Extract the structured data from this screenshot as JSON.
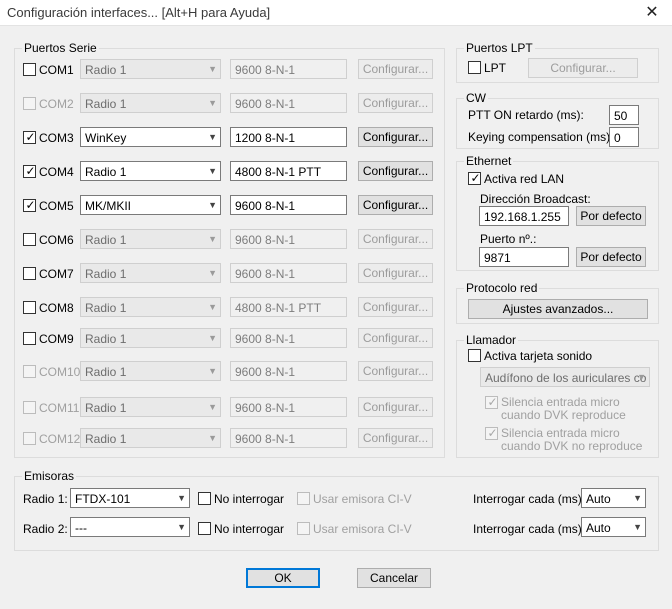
{
  "window": {
    "title": "Configuración interfaces... [Alt+H para Ayuda]",
    "close_glyph": "✕"
  },
  "puertos_serie": {
    "legend": "Puertos Serie",
    "ports": [
      {
        "name": "COM1",
        "checked": false,
        "enabled": true,
        "radio": "Radio 1",
        "radio_enabled": false,
        "speed": "9600 8-N-1",
        "speed_enabled": false,
        "configure": "Configurar...",
        "configure_enabled": false
      },
      {
        "name": "COM2",
        "checked": false,
        "enabled": false,
        "radio": "Radio 1",
        "radio_enabled": false,
        "speed": "9600 8-N-1",
        "speed_enabled": false,
        "configure": "Configurar...",
        "configure_enabled": false
      },
      {
        "name": "COM3",
        "checked": true,
        "enabled": true,
        "radio": "WinKey",
        "radio_enabled": true,
        "speed": "1200 8-N-1",
        "speed_enabled": true,
        "configure": "Configurar...",
        "configure_enabled": true
      },
      {
        "name": "COM4",
        "checked": true,
        "enabled": true,
        "radio": "Radio 1",
        "radio_enabled": true,
        "speed": "4800 8-N-1 PTT",
        "speed_enabled": true,
        "configure": "Configurar...",
        "configure_enabled": true
      },
      {
        "name": "COM5",
        "checked": true,
        "enabled": true,
        "radio": "MK/MKII",
        "radio_enabled": true,
        "speed": "9600 8-N-1",
        "speed_enabled": true,
        "configure": "Configurar...",
        "configure_enabled": true
      },
      {
        "name": "COM6",
        "checked": false,
        "enabled": true,
        "radio": "Radio 1",
        "radio_enabled": false,
        "speed": "9600 8-N-1",
        "speed_enabled": false,
        "configure": "Configurar...",
        "configure_enabled": false
      },
      {
        "name": "COM7",
        "checked": false,
        "enabled": true,
        "radio": "Radio 1",
        "radio_enabled": false,
        "speed": "9600 8-N-1",
        "speed_enabled": false,
        "configure": "Configurar...",
        "configure_enabled": false
      },
      {
        "name": "COM8",
        "checked": false,
        "enabled": true,
        "radio": "Radio 1",
        "radio_enabled": false,
        "speed": "4800 8-N-1 PTT",
        "speed_enabled": false,
        "configure": "Configurar...",
        "configure_enabled": false
      },
      {
        "name": "COM9",
        "checked": false,
        "enabled": true,
        "radio": "Radio 1",
        "radio_enabled": false,
        "speed": "9600 8-N-1",
        "speed_enabled": false,
        "configure": "Configurar...",
        "configure_enabled": false
      },
      {
        "name": "COM10",
        "checked": false,
        "enabled": false,
        "radio": "Radio 1",
        "radio_enabled": false,
        "speed": "9600 8-N-1",
        "speed_enabled": false,
        "configure": "Configurar...",
        "configure_enabled": false
      },
      {
        "name": "COM11",
        "checked": false,
        "enabled": false,
        "radio": "Radio 1",
        "radio_enabled": false,
        "speed": "9600 8-N-1",
        "speed_enabled": false,
        "configure": "Configurar...",
        "configure_enabled": false
      },
      {
        "name": "COM12",
        "checked": false,
        "enabled": false,
        "radio": "Radio 1",
        "radio_enabled": false,
        "speed": "9600 8-N-1",
        "speed_enabled": false,
        "configure": "Configurar...",
        "configure_enabled": false
      }
    ]
  },
  "puertos_lpt": {
    "legend": "Puertos LPT",
    "lpt_label": "LPT",
    "lpt_checked": false,
    "configure": "Configurar..."
  },
  "cw": {
    "legend": "CW",
    "ptt_label": "PTT ON retardo (ms):",
    "ptt_value": "50",
    "keying_label": "Keying compensation (ms):",
    "keying_value": "0"
  },
  "ethernet": {
    "legend": "Ethernet",
    "activa_label": "Activa red LAN",
    "activa_checked": true,
    "broadcast_label": "Dirección Broadcast:",
    "broadcast_value": "192.168.1.255",
    "broadcast_default": "Por defecto",
    "puerto_label": "Puerto nº.:",
    "puerto_value": "9871",
    "puerto_default": "Por defecto"
  },
  "protocolo": {
    "legend": "Protocolo red",
    "button": "Ajustes avanzados..."
  },
  "llamador": {
    "legend": "Llamador",
    "activa_label": "Activa tarjeta sonido",
    "activa_checked": false,
    "device": "Audífono de los auriculares co",
    "silencia1": "Silencia entrada micro cuando DVK reproduce",
    "silencia1_checked": true,
    "silencia2": "Silencia entrada micro cuando DVK no reproduce",
    "silencia2_checked": true
  },
  "emisoras": {
    "legend": "Emisoras",
    "radios": [
      {
        "label": "Radio 1:",
        "value": "FTDX-101",
        "no_interrogar": "No interrogar",
        "usar_civ": "Usar emisora CI-V",
        "interrogar_label": "Interrogar cada (ms):",
        "interrogar_value": "Auto"
      },
      {
        "label": "Radio 2:",
        "value": "---",
        "no_interrogar": "No interrogar",
        "usar_civ": "Usar emisora CI-V",
        "interrogar_label": "Interrogar cada (ms):",
        "interrogar_value": "Auto"
      }
    ]
  },
  "footer": {
    "ok": "OK",
    "cancel": "Cancelar"
  },
  "glyphs": {
    "check": "✓",
    "dropdown": "▼"
  }
}
